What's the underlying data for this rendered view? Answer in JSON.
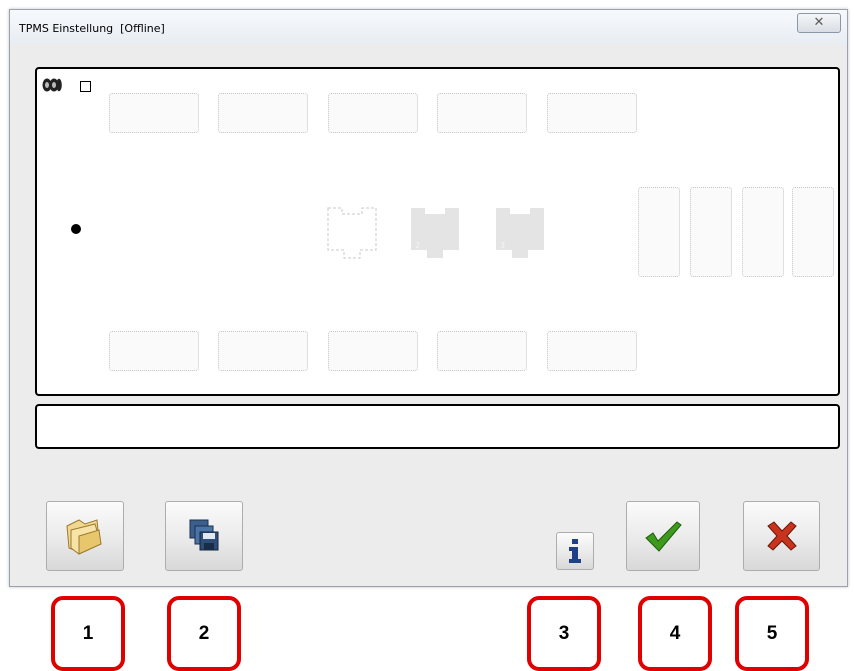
{
  "window": {
    "title": "TPMS Einstellung  [Offline]",
    "close_label": "✕"
  },
  "tire_display": {
    "top_row_slots": 5,
    "bottom_row_slots": 5,
    "side_slots": 4,
    "axle_labels": [
      "2",
      "3"
    ],
    "checkbox_checked": false
  },
  "status_text": "",
  "toolbar": {
    "open_icon": "folder-open-icon",
    "save_icon": "floppy-disks-icon",
    "info_icon": "info-icon",
    "ok_icon": "green-checkmark-icon",
    "cancel_icon": "red-x-icon",
    "ok_color": "#3d9a1c",
    "cancel_color": "#c8331d"
  },
  "markers": {
    "m1": "1",
    "m2": "2",
    "m3": "3",
    "m4": "4",
    "m5": "5",
    "color": "#e00000"
  }
}
